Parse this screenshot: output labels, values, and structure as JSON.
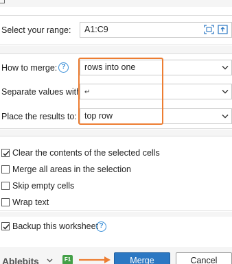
{
  "range": {
    "label": "Select your range:",
    "value": "A1:C9"
  },
  "how_to_merge": {
    "label": "How to merge:",
    "value": "rows into one"
  },
  "separate_values": {
    "label": "Separate values with:",
    "value": "↵"
  },
  "place_results": {
    "label": "Place the results to:",
    "value": "top row"
  },
  "options": [
    {
      "label": "Clear the contents of the selected cells",
      "checked": true
    },
    {
      "label": "Merge all areas in the selection",
      "checked": false
    },
    {
      "label": "Skip empty cells",
      "checked": false
    },
    {
      "label": "Wrap text",
      "checked": false
    }
  ],
  "backup": {
    "label": "Backup this worksheet",
    "checked": true
  },
  "footer": {
    "brand": "Ablebits",
    "shortcut": "F1",
    "merge_label": "Merge",
    "cancel_label": "Cancel"
  },
  "colors": {
    "accent": "#2c78c3",
    "highlight": "#ed7d31",
    "help": "#3a8fd8"
  }
}
